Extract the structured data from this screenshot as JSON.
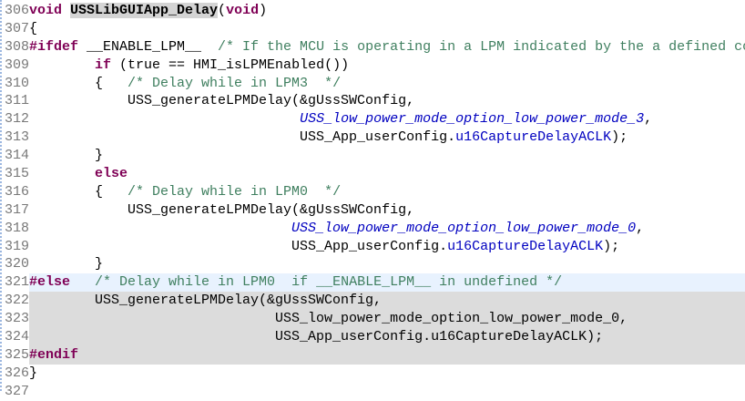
{
  "editor": {
    "lines": [
      {
        "num": "306",
        "state": "",
        "tokens": [
          {
            "t": "void ",
            "c": "kw"
          },
          {
            "t": "USSLibGUIApp_Delay",
            "c": "hl"
          },
          {
            "t": "(",
            "c": "pl"
          },
          {
            "t": "void",
            "c": "kw"
          },
          {
            "t": ")",
            "c": "pl"
          }
        ]
      },
      {
        "num": "307",
        "state": "",
        "tokens": [
          {
            "t": "{",
            "c": "pl"
          }
        ]
      },
      {
        "num": "308",
        "state": "",
        "tokens": [
          {
            "t": "#ifdef",
            "c": "kw"
          },
          {
            "t": " __ENABLE_LPM__  ",
            "c": "pl"
          },
          {
            "t": "/* If the MCU is operating in a LPM indicated by the a defined co",
            "c": "cm"
          }
        ]
      },
      {
        "num": "309",
        "state": "",
        "tokens": [
          {
            "t": "        ",
            "c": "pl"
          },
          {
            "t": "if",
            "c": "kw"
          },
          {
            "t": " (true == HMI_isLPMEnabled())",
            "c": "pl"
          }
        ]
      },
      {
        "num": "310",
        "state": "",
        "tokens": [
          {
            "t": "        {   ",
            "c": "pl"
          },
          {
            "t": "/* Delay while in LPM3  */",
            "c": "cm"
          }
        ]
      },
      {
        "num": "311",
        "state": "",
        "tokens": [
          {
            "t": "            USS_generateLPMDelay(&gUssSWConfig,",
            "c": "pl"
          }
        ]
      },
      {
        "num": "312",
        "state": "",
        "tokens": [
          {
            "t": "                                 ",
            "c": "pl"
          },
          {
            "t": "USS_low_power_mode_option_low_power_mode_3",
            "c": "en"
          },
          {
            "t": ",",
            "c": "pl"
          }
        ]
      },
      {
        "num": "313",
        "state": "",
        "tokens": [
          {
            "t": "                                 USS_App_userConfig.",
            "c": "pl"
          },
          {
            "t": "u16CaptureDelayACLK",
            "c": "fd"
          },
          {
            "t": ");",
            "c": "pl"
          }
        ]
      },
      {
        "num": "314",
        "state": "",
        "tokens": [
          {
            "t": "        }",
            "c": "pl"
          }
        ]
      },
      {
        "num": "315",
        "state": "",
        "tokens": [
          {
            "t": "        ",
            "c": "pl"
          },
          {
            "t": "else",
            "c": "kw"
          }
        ]
      },
      {
        "num": "316",
        "state": "",
        "tokens": [
          {
            "t": "        {   ",
            "c": "pl"
          },
          {
            "t": "/* Delay while in LPM0  */",
            "c": "cm"
          }
        ]
      },
      {
        "num": "317",
        "state": "",
        "tokens": [
          {
            "t": "            USS_generateLPMDelay(&gUssSWConfig,",
            "c": "pl"
          }
        ]
      },
      {
        "num": "318",
        "state": "",
        "tokens": [
          {
            "t": "                                ",
            "c": "pl"
          },
          {
            "t": "USS_low_power_mode_option_low_power_mode_0",
            "c": "en"
          },
          {
            "t": ",",
            "c": "pl"
          }
        ]
      },
      {
        "num": "319",
        "state": "",
        "tokens": [
          {
            "t": "                                USS_App_userConfig.",
            "c": "pl"
          },
          {
            "t": "u16CaptureDelayACLK",
            "c": "fd"
          },
          {
            "t": ");",
            "c": "pl"
          }
        ]
      },
      {
        "num": "320",
        "state": "",
        "tokens": [
          {
            "t": "        }",
            "c": "pl"
          }
        ]
      },
      {
        "num": "321",
        "state": "cur",
        "tokens": [
          {
            "t": "#else",
            "c": "kw"
          },
          {
            "t": "   ",
            "c": "pl"
          },
          {
            "t": "/* Delay while in LPM0  if __ENABLE_LPM__ in undefined */",
            "c": "cm"
          }
        ]
      },
      {
        "num": "322",
        "state": "inactive",
        "tokens": [
          {
            "t": "        USS_generateLPMDelay(&gUssSWConfig,",
            "c": "pl"
          }
        ]
      },
      {
        "num": "323",
        "state": "inactive",
        "tokens": [
          {
            "t": "                              USS_low_power_mode_option_low_power_mode_0,",
            "c": "pl"
          }
        ]
      },
      {
        "num": "324",
        "state": "inactive",
        "tokens": [
          {
            "t": "                              USS_App_userConfig.u16CaptureDelayACLK);",
            "c": "pl"
          }
        ]
      },
      {
        "num": "325",
        "state": "inactive",
        "tokens": [
          {
            "t": "#endif",
            "c": "kw"
          }
        ]
      },
      {
        "num": "326",
        "state": "",
        "tokens": [
          {
            "t": "}",
            "c": "pl"
          }
        ]
      },
      {
        "num": "327",
        "state": "",
        "tokens": []
      }
    ]
  }
}
